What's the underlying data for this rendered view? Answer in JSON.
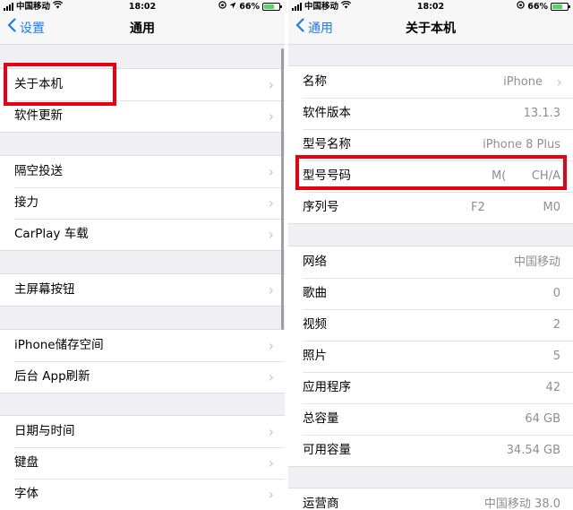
{
  "left": {
    "status": {
      "carrier": "中国移动",
      "time": "18:02",
      "battery": "66%"
    },
    "nav": {
      "back": "设置",
      "title": "通用"
    },
    "groups": [
      [
        "关于本机",
        "软件更新"
      ],
      [
        "隔空投送",
        "接力",
        "CarPlay 车载"
      ],
      [
        "主屏幕按钮"
      ],
      [
        "iPhone储存空间",
        "后台 App刷新"
      ],
      [
        "日期与时间",
        "键盘",
        "字体"
      ]
    ]
  },
  "right": {
    "status": {
      "carrier": "中国移动",
      "time": "18:02",
      "battery": "66%"
    },
    "nav": {
      "back": "通用",
      "title": "关于本机"
    },
    "group1": [
      {
        "label": "名称",
        "value": "iPhone"
      },
      {
        "label": "软件版本",
        "value": "13.1.3"
      },
      {
        "label": "型号名称",
        "value": "iPhone 8 Plus"
      },
      {
        "label": "型号号码",
        "value_a": "M(",
        "value_b": "CH/A"
      },
      {
        "label": "序列号",
        "value_a": "F2",
        "value_b": "M0"
      }
    ],
    "group2": [
      {
        "label": "网络",
        "value": "中国移动"
      },
      {
        "label": "歌曲",
        "value": "0"
      },
      {
        "label": "视频",
        "value": "2"
      },
      {
        "label": "照片",
        "value": "5"
      },
      {
        "label": "应用程序",
        "value": "42"
      },
      {
        "label": "总容量",
        "value": "64 GB"
      },
      {
        "label": "可用容量",
        "value": "34.54 GB"
      }
    ],
    "group3": [
      {
        "label": "运营商",
        "value": "中国移动 38.0"
      }
    ]
  },
  "colors": {
    "accent": "#1a7cf4",
    "highlight": "#e60012",
    "battery": "#4cd964"
  }
}
